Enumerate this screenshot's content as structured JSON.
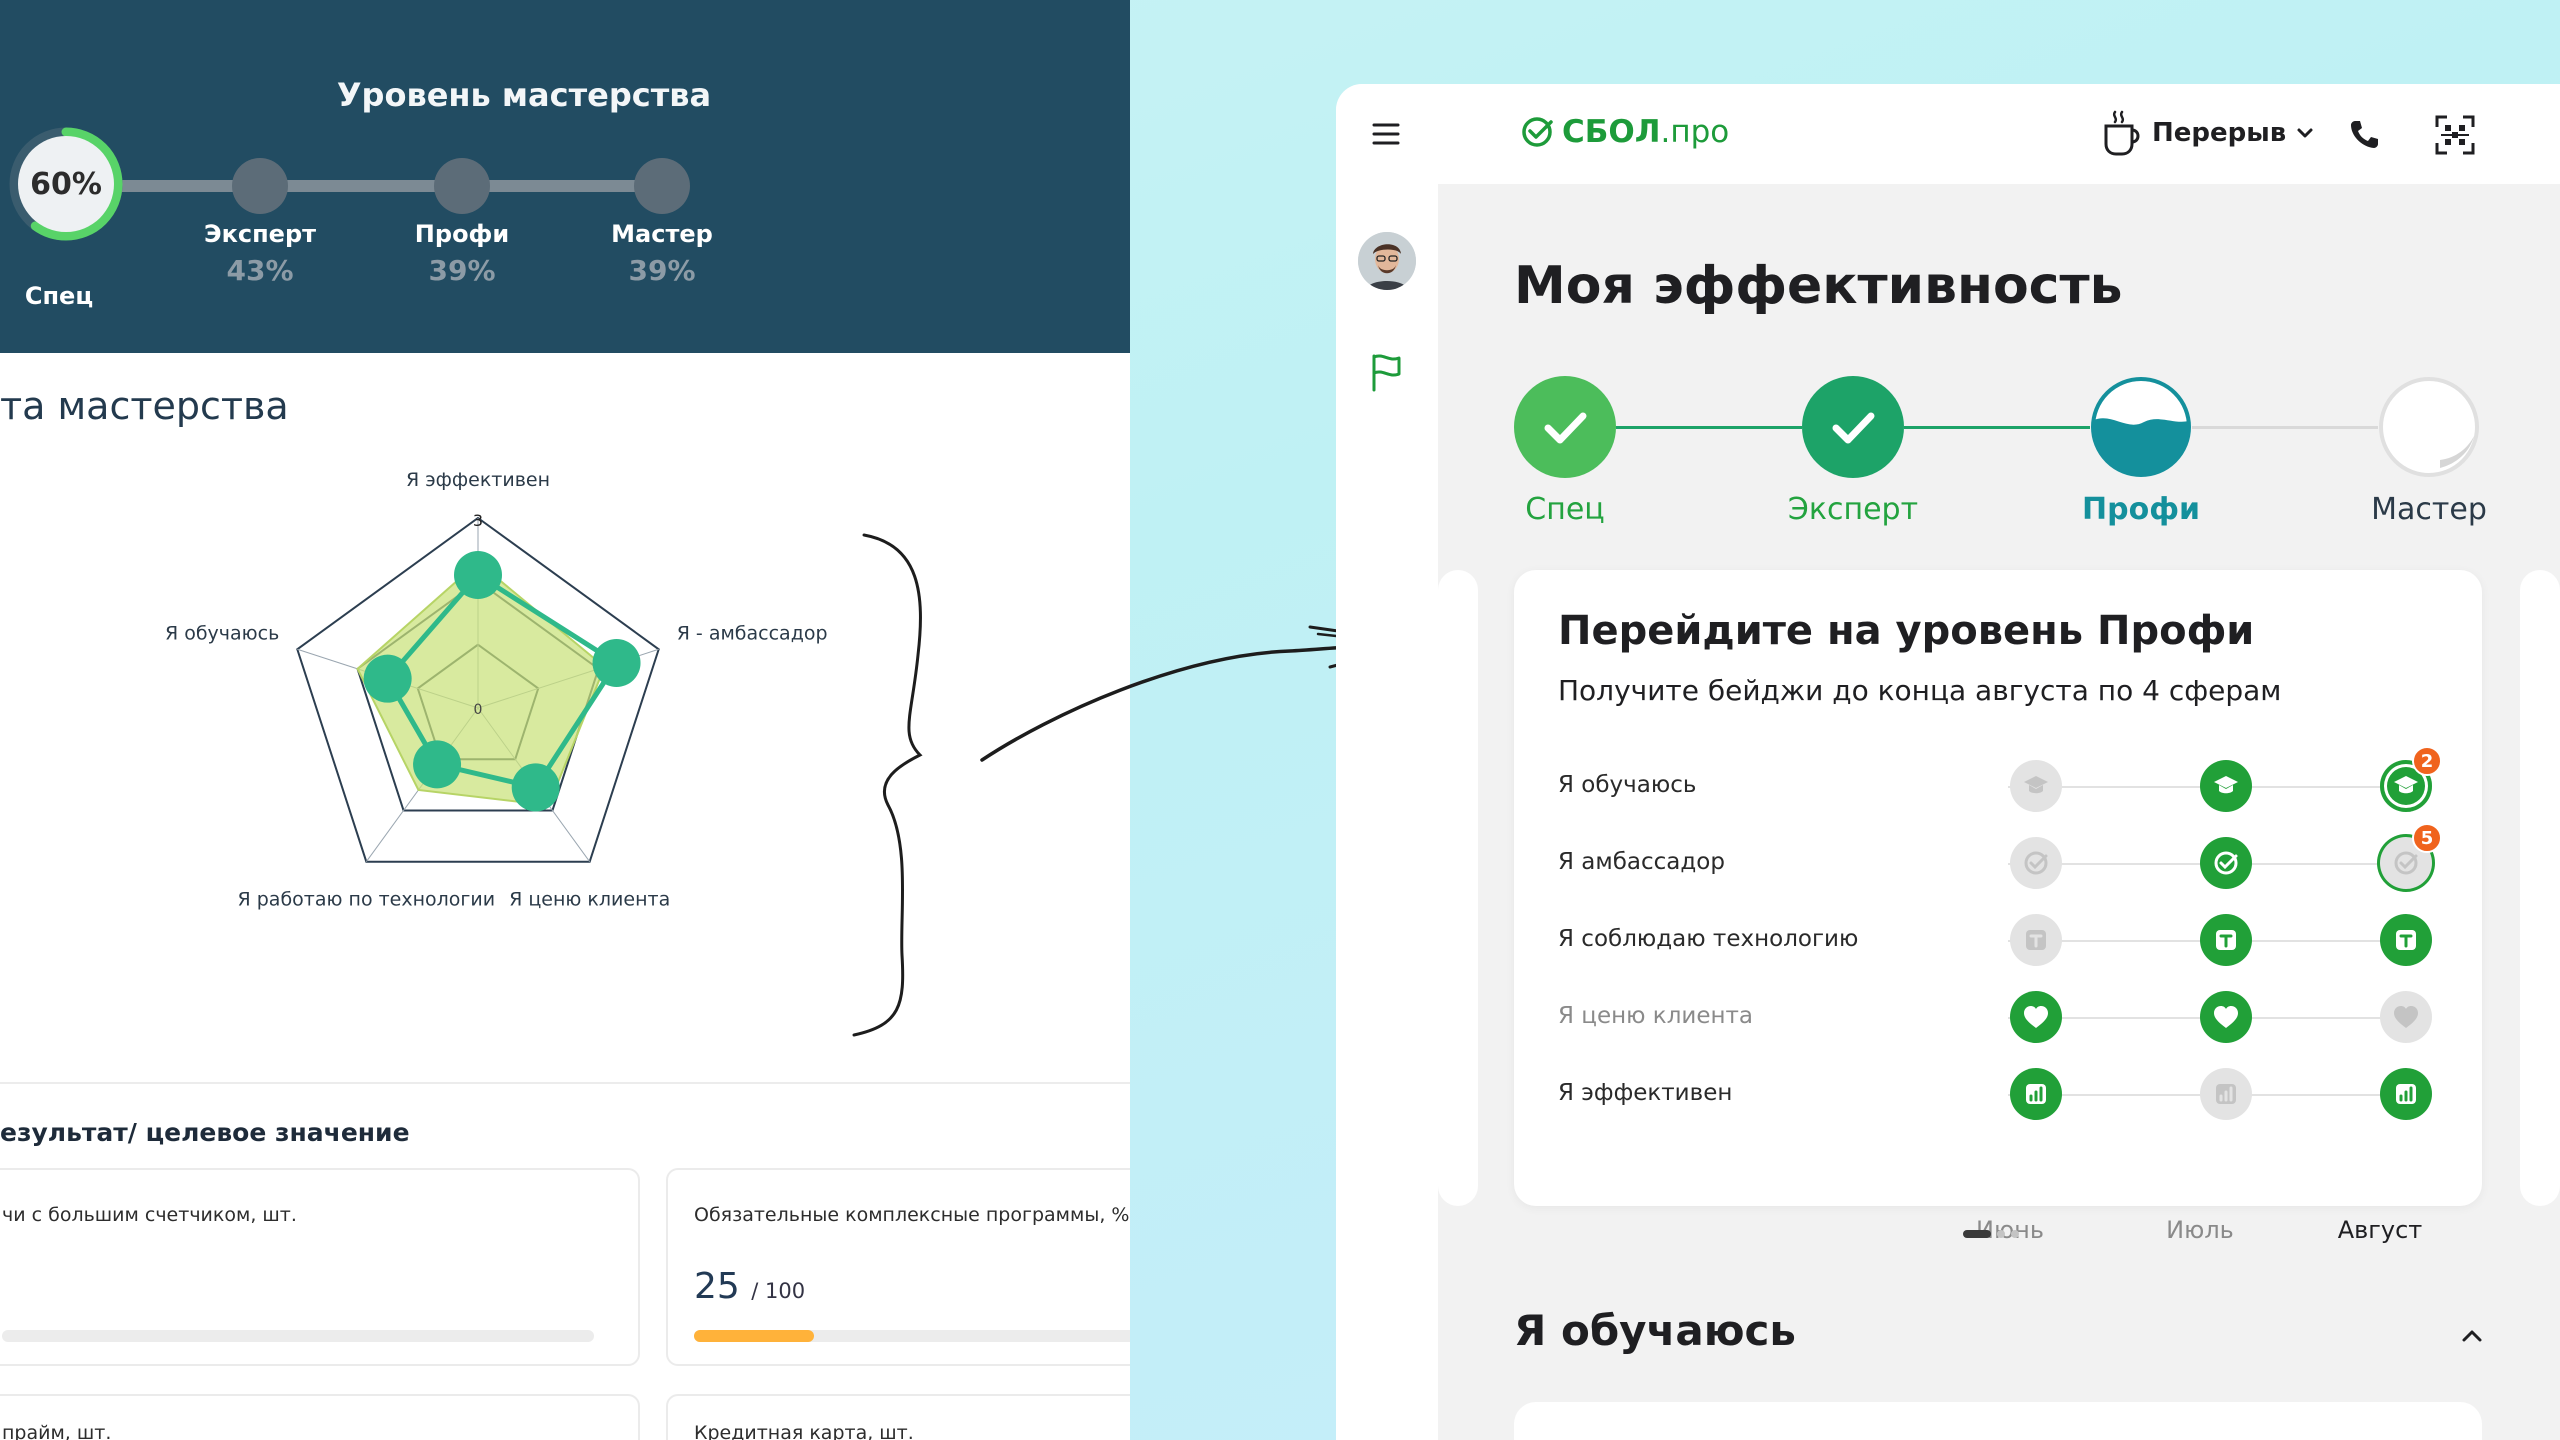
{
  "old_ui": {
    "header": {
      "title": "Уровень мастерства",
      "current": {
        "label": "Спец",
        "percent_text": "60%",
        "progress": 0.6
      },
      "levels": [
        {
          "label": "Эксперт",
          "percent": "43%"
        },
        {
          "label": "Профи",
          "percent": "39%"
        },
        {
          "label": "Мастер",
          "percent": "39%"
        }
      ]
    },
    "radar": {
      "title": "та мастерства",
      "axes": [
        "Я эффективен",
        "Я - амбассадор",
        "Я ценю клиента",
        "Я работаю по технологии",
        "Я обучаюсь"
      ],
      "scale_labels": [
        "3",
        "0"
      ]
    },
    "results": {
      "title": "езультат/ целевое значение",
      "cards": [
        {
          "label": "чи с большим счетчиком, шт."
        },
        {
          "label": "Обязательные комплексные программы, %",
          "value": "25",
          "total": "/ 100",
          "progress": 0.25
        },
        {
          "label": "прайм, шт."
        },
        {
          "label": "Кредитная карта, шт."
        }
      ]
    }
  },
  "chart_data": {
    "type": "radar",
    "title": "",
    "axes": [
      "Я эффективен",
      "Я - амбассадор",
      "Я ценю клиента",
      "Я работаю по технологии",
      "Я обучаюсь"
    ],
    "range": [
      0,
      3
    ],
    "grid_levels": 3,
    "series": [
      {
        "values": [
          2.1,
          2.3,
          1.55,
          1.1,
          1.5
        ],
        "color": "#2fb98a"
      },
      {
        "values": [
          2.3,
          2.1,
          1.9,
          1.6,
          2.0
        ],
        "color": "#c9e27a"
      }
    ]
  },
  "app": {
    "brand": {
      "name": "СБОЛ",
      "suffix": ".про",
      "color": "#1d9b3a"
    },
    "topbar": {
      "break_label": "Перерыв"
    },
    "icons": [
      "menu-icon",
      "avatar",
      "flag-icon",
      "coffee-cup-icon",
      "chevron-down-icon",
      "phone-icon",
      "qr-scan-icon",
      "check-icon"
    ],
    "page_title": "Моя эффективность",
    "steps": [
      {
        "label": "Спец",
        "state": "done",
        "color": "#4cbd5b"
      },
      {
        "label": "Эксперт",
        "state": "done",
        "color": "#1da368"
      },
      {
        "label": "Профи",
        "state": "current",
        "color": "#14909c",
        "fill": 0.5
      },
      {
        "label": "Мастер",
        "state": "locked",
        "color": "#e6e6e6"
      }
    ],
    "goal_card": {
      "title": "Перейдите на уровень Профи",
      "subtitle": "Получите бейджи до конца августа по 4 сферам",
      "rows": [
        {
          "label": "Я обучаюсь",
          "icon": "graduation-cap-icon",
          "states": [
            "off",
            "on",
            "ringed"
          ],
          "counter": "2"
        },
        {
          "label": "Я амбассадор",
          "icon": "check-badge-icon",
          "states": [
            "off",
            "on",
            "ringed-off"
          ],
          "counter": "5"
        },
        {
          "label": "Я соблюдаю технологию",
          "icon": "t-letter-icon",
          "states": [
            "off",
            "on",
            "on"
          ]
        },
        {
          "label": "Я ценю клиента",
          "icon": "heart-icon",
          "states": [
            "on",
            "on",
            "off"
          ],
          "muted": true
        },
        {
          "label": "Я эффективен",
          "icon": "bar-chart-icon",
          "states": [
            "on",
            "off",
            "on"
          ]
        }
      ],
      "months": [
        "Июнь",
        "Июль",
        "Август"
      ],
      "current_month_index": 2
    },
    "pager": {
      "count": 3,
      "active": 0
    },
    "section": {
      "title": "Я обучаюсь"
    }
  }
}
